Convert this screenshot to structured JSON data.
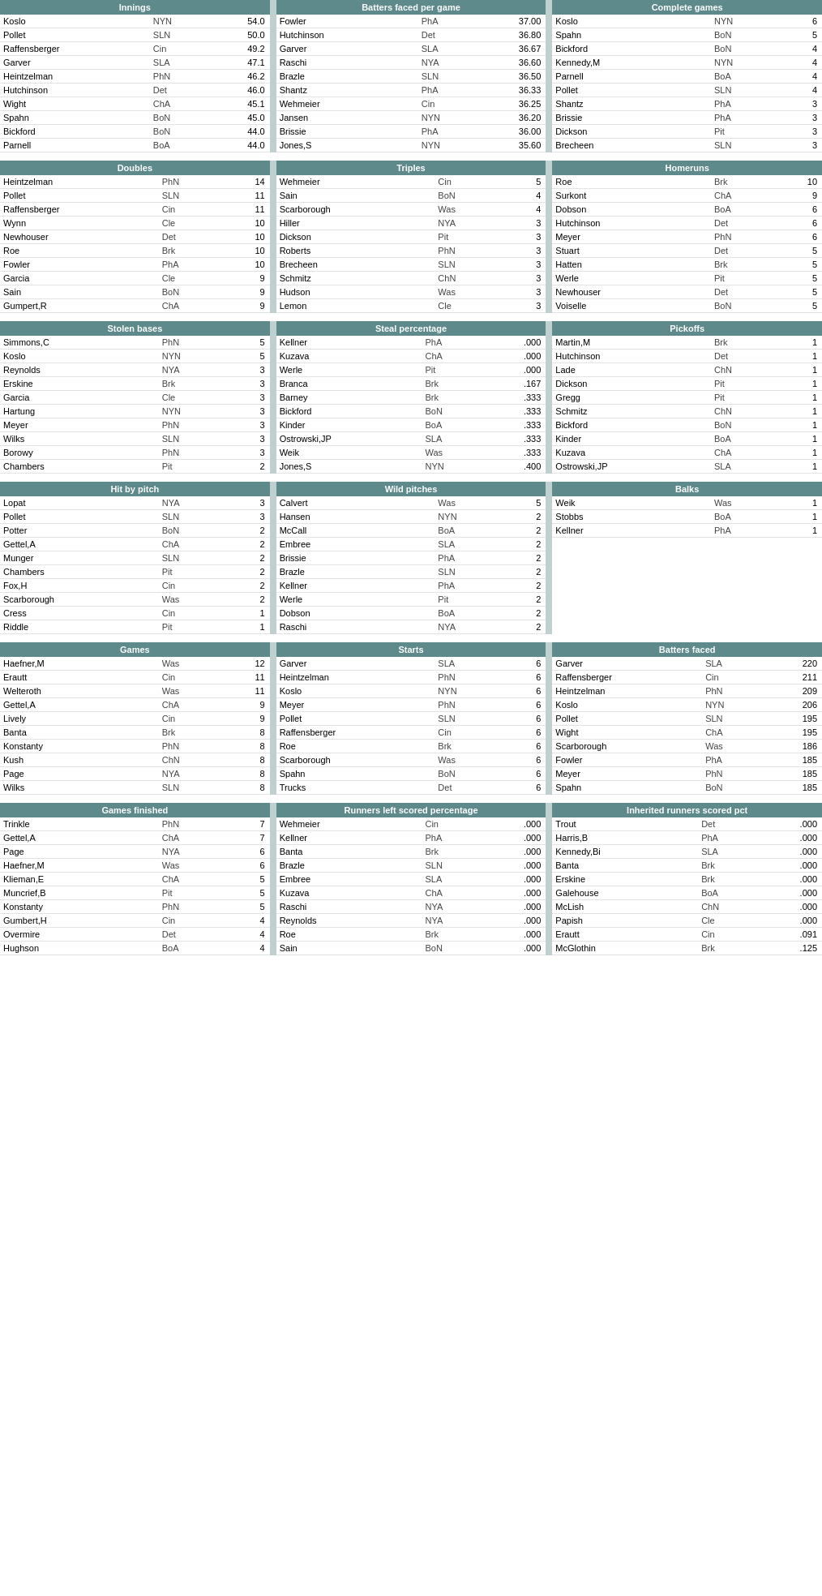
{
  "sections": {
    "innings": {
      "title": "Innings",
      "rows": [
        {
          "name": "Koslo",
          "team": "NYN",
          "val": "54.0"
        },
        {
          "name": "Pollet",
          "team": "SLN",
          "val": "50.0"
        },
        {
          "name": "Raffensberger",
          "team": "Cin",
          "val": "49.2"
        },
        {
          "name": "Garver",
          "team": "SLA",
          "val": "47.1"
        },
        {
          "name": "Heintzelman",
          "team": "PhN",
          "val": "46.2"
        },
        {
          "name": "Hutchinson",
          "team": "Det",
          "val": "46.0"
        },
        {
          "name": "Wight",
          "team": "ChA",
          "val": "45.1"
        },
        {
          "name": "Spahn",
          "team": "BoN",
          "val": "45.0"
        },
        {
          "name": "Bickford",
          "team": "BoN",
          "val": "44.0"
        },
        {
          "name": "Parnell",
          "team": "BoA",
          "val": "44.0"
        }
      ]
    },
    "batters_faced_per_game": {
      "title": "Batters faced per game",
      "rows": [
        {
          "name": "Fowler",
          "team": "PhA",
          "val": "37.00"
        },
        {
          "name": "Hutchinson",
          "team": "Det",
          "val": "36.80"
        },
        {
          "name": "Garver",
          "team": "SLA",
          "val": "36.67"
        },
        {
          "name": "Raschi",
          "team": "NYA",
          "val": "36.60"
        },
        {
          "name": "Brazle",
          "team": "SLN",
          "val": "36.50"
        },
        {
          "name": "Shantz",
          "team": "PhA",
          "val": "36.33"
        },
        {
          "name": "Wehmeier",
          "team": "Cin",
          "val": "36.25"
        },
        {
          "name": "Jansen",
          "team": "NYN",
          "val": "36.20"
        },
        {
          "name": "Brissie",
          "team": "PhA",
          "val": "36.00"
        },
        {
          "name": "Jones,S",
          "team": "NYN",
          "val": "35.60"
        }
      ]
    },
    "complete_games": {
      "title": "Complete games",
      "rows": [
        {
          "name": "Koslo",
          "team": "NYN",
          "val": "6"
        },
        {
          "name": "Spahn",
          "team": "BoN",
          "val": "5"
        },
        {
          "name": "Bickford",
          "team": "BoN",
          "val": "4"
        },
        {
          "name": "Kennedy,M",
          "team": "NYN",
          "val": "4"
        },
        {
          "name": "Parnell",
          "team": "BoA",
          "val": "4"
        },
        {
          "name": "Pollet",
          "team": "SLN",
          "val": "4"
        },
        {
          "name": "Shantz",
          "team": "PhA",
          "val": "3"
        },
        {
          "name": "Brissie",
          "team": "PhA",
          "val": "3"
        },
        {
          "name": "Dickson",
          "team": "Pit",
          "val": "3"
        },
        {
          "name": "Brecheen",
          "team": "SLN",
          "val": "3"
        }
      ]
    },
    "doubles": {
      "title": "Doubles",
      "rows": [
        {
          "name": "Heintzelman",
          "team": "PhN",
          "val": "14"
        },
        {
          "name": "Pollet",
          "team": "SLN",
          "val": "11"
        },
        {
          "name": "Raffensberger",
          "team": "Cin",
          "val": "11"
        },
        {
          "name": "Wynn",
          "team": "Cle",
          "val": "10"
        },
        {
          "name": "Newhouser",
          "team": "Det",
          "val": "10"
        },
        {
          "name": "Roe",
          "team": "Brk",
          "val": "10"
        },
        {
          "name": "Fowler",
          "team": "PhA",
          "val": "10"
        },
        {
          "name": "Garcia",
          "team": "Cle",
          "val": "9"
        },
        {
          "name": "Sain",
          "team": "BoN",
          "val": "9"
        },
        {
          "name": "Gumpert,R",
          "team": "ChA",
          "val": "9"
        }
      ]
    },
    "triples": {
      "title": "Triples",
      "rows": [
        {
          "name": "Wehmeier",
          "team": "Cin",
          "val": "5"
        },
        {
          "name": "Sain",
          "team": "BoN",
          "val": "4"
        },
        {
          "name": "Scarborough",
          "team": "Was",
          "val": "4"
        },
        {
          "name": "Hiller",
          "team": "NYA",
          "val": "3"
        },
        {
          "name": "Dickson",
          "team": "Pit",
          "val": "3"
        },
        {
          "name": "Roberts",
          "team": "PhN",
          "val": "3"
        },
        {
          "name": "Brecheen",
          "team": "SLN",
          "val": "3"
        },
        {
          "name": "Schmitz",
          "team": "ChN",
          "val": "3"
        },
        {
          "name": "Hudson",
          "team": "Was",
          "val": "3"
        },
        {
          "name": "Lemon",
          "team": "Cle",
          "val": "3"
        }
      ]
    },
    "homeruns": {
      "title": "Homeruns",
      "rows": [
        {
          "name": "Roe",
          "team": "Brk",
          "val": "10"
        },
        {
          "name": "Surkont",
          "team": "ChA",
          "val": "9"
        },
        {
          "name": "Dobson",
          "team": "BoA",
          "val": "6"
        },
        {
          "name": "Hutchinson",
          "team": "Det",
          "val": "6"
        },
        {
          "name": "Meyer",
          "team": "PhN",
          "val": "6"
        },
        {
          "name": "Stuart",
          "team": "Det",
          "val": "5"
        },
        {
          "name": "Hatten",
          "team": "Brk",
          "val": "5"
        },
        {
          "name": "Werle",
          "team": "Pit",
          "val": "5"
        },
        {
          "name": "Newhouser",
          "team": "Det",
          "val": "5"
        },
        {
          "name": "Voiselle",
          "team": "BoN",
          "val": "5"
        }
      ]
    },
    "stolen_bases": {
      "title": "Stolen bases",
      "rows": [
        {
          "name": "Simmons,C",
          "team": "PhN",
          "val": "5"
        },
        {
          "name": "Koslo",
          "team": "NYN",
          "val": "5"
        },
        {
          "name": "Reynolds",
          "team": "NYA",
          "val": "3"
        },
        {
          "name": "Erskine",
          "team": "Brk",
          "val": "3"
        },
        {
          "name": "Garcia",
          "team": "Cle",
          "val": "3"
        },
        {
          "name": "Hartung",
          "team": "NYN",
          "val": "3"
        },
        {
          "name": "Meyer",
          "team": "PhN",
          "val": "3"
        },
        {
          "name": "Wilks",
          "team": "SLN",
          "val": "3"
        },
        {
          "name": "Borowy",
          "team": "PhN",
          "val": "3"
        },
        {
          "name": "Chambers",
          "team": "Pit",
          "val": "2"
        }
      ]
    },
    "steal_percentage": {
      "title": "Steal percentage",
      "rows": [
        {
          "name": "Kellner",
          "team": "PhA",
          "val": ".000"
        },
        {
          "name": "Kuzava",
          "team": "ChA",
          "val": ".000"
        },
        {
          "name": "Werle",
          "team": "Pit",
          "val": ".000"
        },
        {
          "name": "Branca",
          "team": "Brk",
          "val": ".167"
        },
        {
          "name": "Barney",
          "team": "Brk",
          "val": ".333"
        },
        {
          "name": "Bickford",
          "team": "BoN",
          "val": ".333"
        },
        {
          "name": "Kinder",
          "team": "BoA",
          "val": ".333"
        },
        {
          "name": "Ostrowski,JP",
          "team": "SLA",
          "val": ".333"
        },
        {
          "name": "Weik",
          "team": "Was",
          "val": ".333"
        },
        {
          "name": "Jones,S",
          "team": "NYN",
          "val": ".400"
        }
      ]
    },
    "pickoffs": {
      "title": "Pickoffs",
      "rows": [
        {
          "name": "Martin,M",
          "team": "Brk",
          "val": "1"
        },
        {
          "name": "Hutchinson",
          "team": "Det",
          "val": "1"
        },
        {
          "name": "Lade",
          "team": "ChN",
          "val": "1"
        },
        {
          "name": "Dickson",
          "team": "Pit",
          "val": "1"
        },
        {
          "name": "Gregg",
          "team": "Pit",
          "val": "1"
        },
        {
          "name": "Schmitz",
          "team": "ChN",
          "val": "1"
        },
        {
          "name": "Bickford",
          "team": "BoN",
          "val": "1"
        },
        {
          "name": "Kinder",
          "team": "BoA",
          "val": "1"
        },
        {
          "name": "Kuzava",
          "team": "ChA",
          "val": "1"
        },
        {
          "name": "Ostrowski,JP",
          "team": "SLA",
          "val": "1"
        }
      ]
    },
    "hit_by_pitch": {
      "title": "Hit by pitch",
      "rows": [
        {
          "name": "Lopat",
          "team": "NYA",
          "val": "3"
        },
        {
          "name": "Pollet",
          "team": "SLN",
          "val": "3"
        },
        {
          "name": "Potter",
          "team": "BoN",
          "val": "2"
        },
        {
          "name": "Gettel,A",
          "team": "ChA",
          "val": "2"
        },
        {
          "name": "Munger",
          "team": "SLN",
          "val": "2"
        },
        {
          "name": "Chambers",
          "team": "Pit",
          "val": "2"
        },
        {
          "name": "Fox,H",
          "team": "Cin",
          "val": "2"
        },
        {
          "name": "Scarborough",
          "team": "Was",
          "val": "2"
        },
        {
          "name": "Cress",
          "team": "Cin",
          "val": "1"
        },
        {
          "name": "Riddle",
          "team": "Pit",
          "val": "1"
        }
      ]
    },
    "wild_pitches": {
      "title": "Wild pitches",
      "rows": [
        {
          "name": "Calvert",
          "team": "Was",
          "val": "5"
        },
        {
          "name": "Hansen",
          "team": "NYN",
          "val": "2"
        },
        {
          "name": "McCall",
          "team": "BoA",
          "val": "2"
        },
        {
          "name": "Embree",
          "team": "SLA",
          "val": "2"
        },
        {
          "name": "Brissie",
          "team": "PhA",
          "val": "2"
        },
        {
          "name": "Brazle",
          "team": "SLN",
          "val": "2"
        },
        {
          "name": "Kellner",
          "team": "PhA",
          "val": "2"
        },
        {
          "name": "Werle",
          "team": "Pit",
          "val": "2"
        },
        {
          "name": "Dobson",
          "team": "BoA",
          "val": "2"
        },
        {
          "name": "Raschi",
          "team": "NYA",
          "val": "2"
        }
      ]
    },
    "balks": {
      "title": "Balks",
      "rows": [
        {
          "name": "Weik",
          "team": "Was",
          "val": "1"
        },
        {
          "name": "Stobbs",
          "team": "BoA",
          "val": "1"
        },
        {
          "name": "Kellner",
          "team": "PhA",
          "val": "1"
        }
      ]
    },
    "games": {
      "title": "Games",
      "rows": [
        {
          "name": "Haefner,M",
          "team": "Was",
          "val": "12"
        },
        {
          "name": "Erautt",
          "team": "Cin",
          "val": "11"
        },
        {
          "name": "Welteroth",
          "team": "Was",
          "val": "11"
        },
        {
          "name": "Gettel,A",
          "team": "ChA",
          "val": "9"
        },
        {
          "name": "Lively",
          "team": "Cin",
          "val": "9"
        },
        {
          "name": "Banta",
          "team": "Brk",
          "val": "8"
        },
        {
          "name": "Konstanty",
          "team": "PhN",
          "val": "8"
        },
        {
          "name": "Kush",
          "team": "ChN",
          "val": "8"
        },
        {
          "name": "Page",
          "team": "NYA",
          "val": "8"
        },
        {
          "name": "Wilks",
          "team": "SLN",
          "val": "8"
        }
      ]
    },
    "starts": {
      "title": "Starts",
      "rows": [
        {
          "name": "Garver",
          "team": "SLA",
          "val": "6"
        },
        {
          "name": "Heintzelman",
          "team": "PhN",
          "val": "6"
        },
        {
          "name": "Koslo",
          "team": "NYN",
          "val": "6"
        },
        {
          "name": "Meyer",
          "team": "PhN",
          "val": "6"
        },
        {
          "name": "Pollet",
          "team": "SLN",
          "val": "6"
        },
        {
          "name": "Raffensberger",
          "team": "Cin",
          "val": "6"
        },
        {
          "name": "Roe",
          "team": "Brk",
          "val": "6"
        },
        {
          "name": "Scarborough",
          "team": "Was",
          "val": "6"
        },
        {
          "name": "Spahn",
          "team": "BoN",
          "val": "6"
        },
        {
          "name": "Trucks",
          "team": "Det",
          "val": "6"
        }
      ]
    },
    "batters_faced": {
      "title": "Batters faced",
      "rows": [
        {
          "name": "Garver",
          "team": "SLA",
          "val": "220"
        },
        {
          "name": "Raffensberger",
          "team": "Cin",
          "val": "211"
        },
        {
          "name": "Heintzelman",
          "team": "PhN",
          "val": "209"
        },
        {
          "name": "Koslo",
          "team": "NYN",
          "val": "206"
        },
        {
          "name": "Pollet",
          "team": "SLN",
          "val": "195"
        },
        {
          "name": "Wight",
          "team": "ChA",
          "val": "195"
        },
        {
          "name": "Scarborough",
          "team": "Was",
          "val": "186"
        },
        {
          "name": "Fowler",
          "team": "PhA",
          "val": "185"
        },
        {
          "name": "Meyer",
          "team": "PhN",
          "val": "185"
        },
        {
          "name": "Spahn",
          "team": "BoN",
          "val": "185"
        }
      ]
    },
    "games_finished": {
      "title": "Games finished",
      "rows": [
        {
          "name": "Trinkle",
          "team": "PhN",
          "val": "7"
        },
        {
          "name": "Gettel,A",
          "team": "ChA",
          "val": "7"
        },
        {
          "name": "Page",
          "team": "NYA",
          "val": "6"
        },
        {
          "name": "Haefner,M",
          "team": "Was",
          "val": "6"
        },
        {
          "name": "Klieman,E",
          "team": "ChA",
          "val": "5"
        },
        {
          "name": "Muncrief,B",
          "team": "Pit",
          "val": "5"
        },
        {
          "name": "Konstanty",
          "team": "PhN",
          "val": "5"
        },
        {
          "name": "Gumbert,H",
          "team": "Cin",
          "val": "4"
        },
        {
          "name": "Overmire",
          "team": "Det",
          "val": "4"
        },
        {
          "name": "Hughson",
          "team": "BoA",
          "val": "4"
        }
      ]
    },
    "runners_left_scored_pct": {
      "title": "Runners left scored percentage",
      "rows": [
        {
          "name": "Wehmeier",
          "team": "Cin",
          "val": ".000"
        },
        {
          "name": "Kellner",
          "team": "PhA",
          "val": ".000"
        },
        {
          "name": "Banta",
          "team": "Brk",
          "val": ".000"
        },
        {
          "name": "Brazle",
          "team": "SLN",
          "val": ".000"
        },
        {
          "name": "Embree",
          "team": "SLA",
          "val": ".000"
        },
        {
          "name": "Kuzava",
          "team": "ChA",
          "val": ".000"
        },
        {
          "name": "Raschi",
          "team": "NYA",
          "val": ".000"
        },
        {
          "name": "Reynolds",
          "team": "NYA",
          "val": ".000"
        },
        {
          "name": "Roe",
          "team": "Brk",
          "val": ".000"
        },
        {
          "name": "Sain",
          "team": "BoN",
          "val": ".000"
        }
      ]
    },
    "inherited_runners_scored_pct": {
      "title": "Inherited runners scored pct",
      "rows": [
        {
          "name": "Trout",
          "team": "Det",
          "val": ".000"
        },
        {
          "name": "Harris,B",
          "team": "PhA",
          "val": ".000"
        },
        {
          "name": "Kennedy,Bi",
          "team": "SLA",
          "val": ".000"
        },
        {
          "name": "Banta",
          "team": "Brk",
          "val": ".000"
        },
        {
          "name": "Erskine",
          "team": "Brk",
          "val": ".000"
        },
        {
          "name": "Galehouse",
          "team": "BoA",
          "val": ".000"
        },
        {
          "name": "McLish",
          "team": "ChN",
          "val": ".000"
        },
        {
          "name": "Papish",
          "team": "Cle",
          "val": ".000"
        },
        {
          "name": "Erautt",
          "team": "Cin",
          "val": ".091"
        },
        {
          "name": "McGlothin",
          "team": "Brk",
          "val": ".125"
        }
      ]
    }
  }
}
